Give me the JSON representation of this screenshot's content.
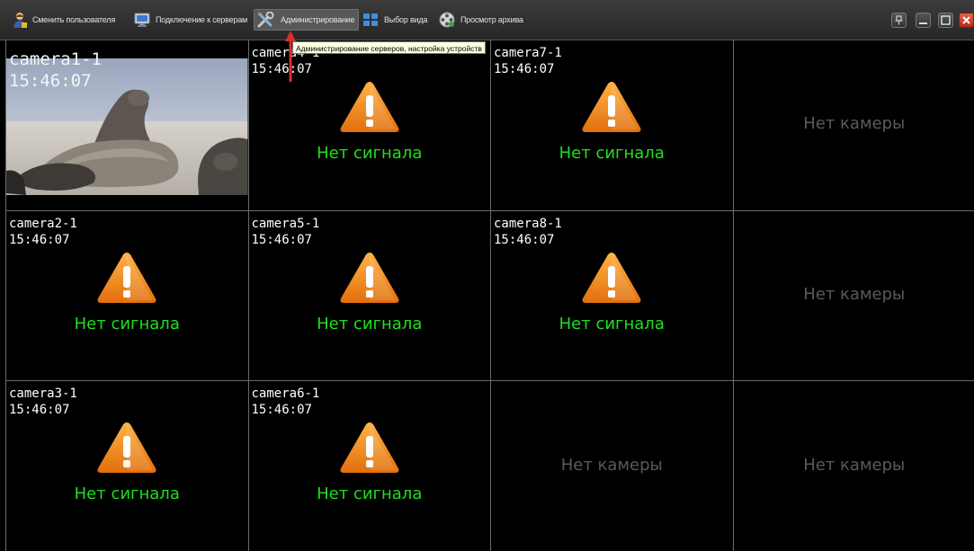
{
  "toolbar": {
    "buttons": [
      {
        "label": "Сменить пользователя",
        "icon": "user-icon"
      },
      {
        "label": "Подключение к серверам",
        "icon": "monitor-icon"
      },
      {
        "label": "Администрирование",
        "icon": "tools-icon",
        "active": true
      },
      {
        "label": "Выбор вида",
        "icon": "layout-grid-icon"
      },
      {
        "label": "Просмотр архива",
        "icon": "film-reel-icon"
      }
    ],
    "tooltip": "Администрирование серверов, настройка устройств",
    "window_controls": [
      "pin-icon",
      "minimize-icon",
      "maximize-icon",
      "close-icon"
    ]
  },
  "grid": {
    "columns": 4,
    "rows": 3,
    "cells": [
      {
        "status": "live",
        "camera": "camera1-1",
        "time": "15:46:07"
      },
      {
        "status": "no_signal",
        "camera": "camera4-1",
        "time": "15:46:07"
      },
      {
        "status": "no_signal",
        "camera": "camera7-1",
        "time": "15:46:07"
      },
      {
        "status": "empty"
      },
      {
        "status": "no_signal",
        "camera": "camera2-1",
        "time": "15:46:07"
      },
      {
        "status": "no_signal",
        "camera": "camera5-1",
        "time": "15:46:07"
      },
      {
        "status": "no_signal",
        "camera": "camera8-1",
        "time": "15:46:07"
      },
      {
        "status": "empty"
      },
      {
        "status": "no_signal",
        "camera": "camera3-1",
        "time": "15:46:07"
      },
      {
        "status": "no_signal",
        "camera": "camera6-1",
        "time": "15:46:07"
      },
      {
        "status": "empty"
      },
      {
        "status": "empty"
      }
    ],
    "no_signal_text": "Нет сигнала",
    "no_camera_text": "Нет камеры"
  },
  "colors": {
    "no_signal_text": "#1fe01f",
    "no_camera_text": "#5a5a5a",
    "warning_icon": "#f08a1c",
    "annotation_arrow": "#d9302a"
  }
}
